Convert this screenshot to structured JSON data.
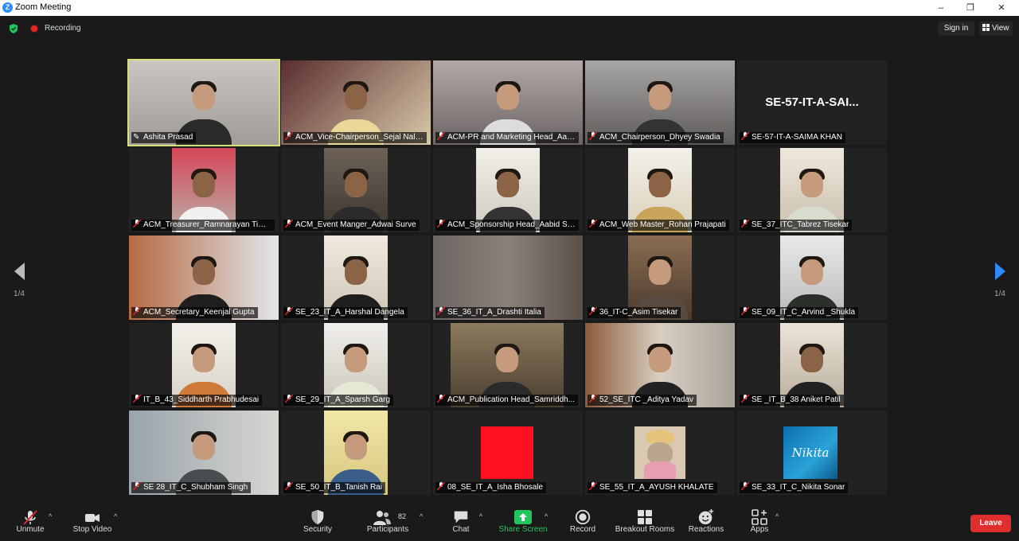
{
  "window": {
    "title": "Zoom Meeting",
    "minimize": "–",
    "maximize": "❐",
    "close": "✕",
    "app_icon_letter": "Z"
  },
  "status": {
    "recording_label": "Recording"
  },
  "top_right": {
    "sign_in": "Sign in",
    "view": "View"
  },
  "pagination": {
    "left_page": "1/4",
    "right_page": "1/4"
  },
  "participants": [
    {
      "name": "Ashita Prasad",
      "active": true,
      "mic_muted": false
    },
    {
      "name": "ACM_Vice-Chairperson_Sejal Nala...",
      "mic_muted": true
    },
    {
      "name": "ACM-PR and Marketing Head_Aay...",
      "mic_muted": true
    },
    {
      "name": "ACM_Chairperson_Dhyey Swadia",
      "mic_muted": true
    },
    {
      "name": "SE-57-IT-A-SAIMA KHAN",
      "avatar_text": "SE-57-IT-A-SAI...",
      "mic_muted": true
    },
    {
      "name": "ACM_Treasurer_Ramnarayan Tiwari",
      "mic_muted": true
    },
    {
      "name": "ACM_Event Manger_Adwai Surve",
      "mic_muted": true
    },
    {
      "name": "ACM_Sponsorship Head_Aabid Sh...",
      "mic_muted": true
    },
    {
      "name": "ACM_Web Master_Rohan Prajapati",
      "mic_muted": true
    },
    {
      "name": "SE_37_ITC_Tabrez Tisekar",
      "mic_muted": true
    },
    {
      "name": "ACM_Secretary_Keenjal Gupta",
      "mic_muted": true
    },
    {
      "name": "SE_23_IT_A_Harshal Dangela",
      "mic_muted": true
    },
    {
      "name": "SE_36_IT_A_Drashti Italia",
      "mic_muted": true
    },
    {
      "name": "36_IT-C_Asim Tisekar",
      "mic_muted": true
    },
    {
      "name": "SE_09_IT_C_Arvind _Shukla",
      "mic_muted": true
    },
    {
      "name": "IT_B_43_Siddharth Prabhudesai",
      "mic_muted": true
    },
    {
      "name": "SE_29_IT_A_Sparsh Garg",
      "mic_muted": true
    },
    {
      "name": "ACM_Publication Head_Samriddh...",
      "mic_muted": true
    },
    {
      "name": "52_SE_ITC _Aditya Yadav",
      "mic_muted": true
    },
    {
      "name": "SE _IT_B_38 Aniket Patil",
      "mic_muted": true
    },
    {
      "name": "SE 28_IT_C_Shubham Singh",
      "mic_muted": true
    },
    {
      "name": "SE_50_IT_B_Tanish Rai",
      "mic_muted": true
    },
    {
      "name": "08_SE_IT_A_Isha Bhosale",
      "mic_muted": true
    },
    {
      "name": "SE_55_IT_A_AYUSH KHALATE",
      "mic_muted": true
    },
    {
      "name": "SE_33_IT_C_Nikita Sonar",
      "mic_muted": true
    }
  ],
  "nikita_image_text": "Nikita",
  "toolbar": {
    "unmute": "Unmute",
    "stop_video": "Stop Video",
    "security": "Security",
    "participants": "Participants",
    "participants_count": "82",
    "chat": "Chat",
    "share_screen": "Share Screen",
    "record": "Record",
    "breakout_rooms": "Breakout Rooms",
    "reactions": "Reactions",
    "apps": "Apps",
    "leave": "Leave",
    "caret": "^"
  },
  "colors": {
    "accent": "#2d8cff",
    "leave": "#e02e2e",
    "share": "#22c55e",
    "active_speaker": "#d7e07a",
    "recording": "#e02828"
  }
}
